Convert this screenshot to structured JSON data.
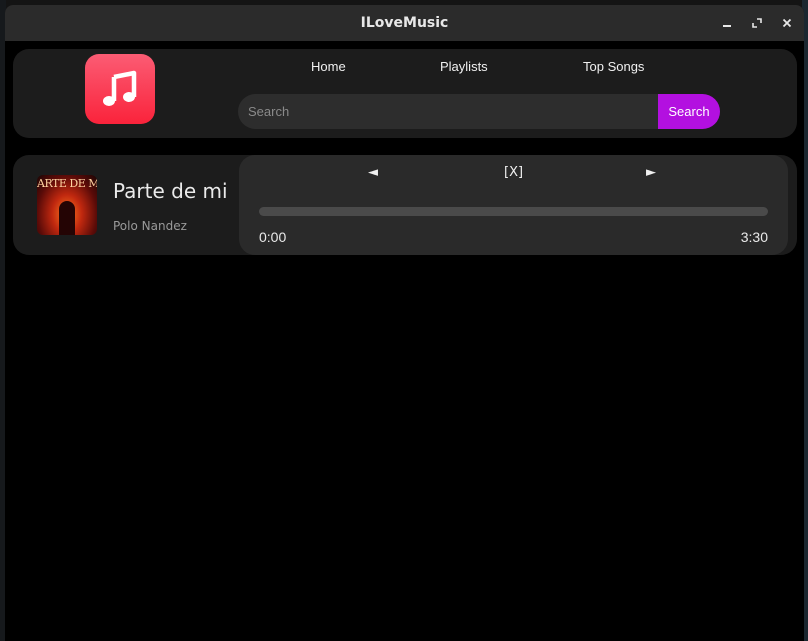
{
  "window": {
    "title": "ILoveMusic"
  },
  "titlebar_buttons": [
    {
      "name": "minimize-button",
      "icon": "minimize-icon"
    },
    {
      "name": "maximize-button",
      "icon": "maximize-icon"
    },
    {
      "name": "close-button",
      "icon": "close-icon"
    }
  ],
  "header": {
    "logo_icon": "music-note-icon",
    "nav": {
      "home": "Home",
      "playlists": "Playlists",
      "top_songs": "Top Songs"
    },
    "search": {
      "placeholder": "Search",
      "value": "",
      "button_label": "Search"
    }
  },
  "now_playing": {
    "album_art_text": "ARTE DE MI",
    "title": "Parte de mi",
    "artist": "Polo Nandez",
    "controls": {
      "prev": "◄",
      "stop": "[X]",
      "next": "►"
    },
    "current_time": "0:00",
    "total_time": "3:30",
    "progress": 0
  },
  "colors": {
    "accent": "#b310e0",
    "logo_gradient_top": "#fb5c74",
    "logo_gradient_bottom": "#fa233b",
    "card_bg": "#1c1c1c",
    "panel_bg": "#2a2a2a"
  }
}
